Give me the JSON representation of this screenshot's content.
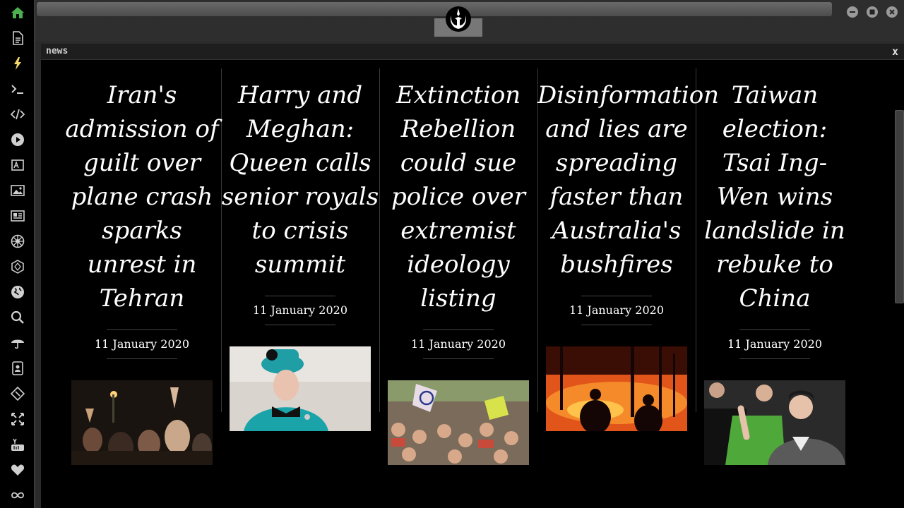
{
  "sidebar": {
    "icons": [
      {
        "name": "home-icon",
        "color": "#4caf50"
      },
      {
        "name": "document-icon",
        "color": "#cfcfcf"
      },
      {
        "name": "lightning-icon",
        "color": "#f5d76e"
      },
      {
        "name": "terminal-icon",
        "color": "#cfcfcf"
      },
      {
        "name": "code-icon",
        "color": "#cfcfcf"
      },
      {
        "name": "play-icon",
        "color": "#cfcfcf"
      },
      {
        "name": "translate-icon",
        "color": "#cfcfcf"
      },
      {
        "name": "image-icon",
        "color": "#cfcfcf"
      },
      {
        "name": "newspaper-icon",
        "color": "#cfcfcf"
      },
      {
        "name": "empire-icon",
        "color": "#cfcfcf"
      },
      {
        "name": "hexagon-icon",
        "color": "#cfcfcf"
      },
      {
        "name": "globe-icon",
        "color": "#cfcfcf"
      },
      {
        "name": "search-icon",
        "color": "#cfcfcf"
      },
      {
        "name": "umbrella-icon",
        "color": "#cfcfcf"
      },
      {
        "name": "contact-icon",
        "color": "#cfcfcf"
      },
      {
        "name": "git-icon",
        "color": "#cfcfcf"
      },
      {
        "name": "expand-icon",
        "color": "#cfcfcf"
      },
      {
        "name": "youtube-icon",
        "color": "#cfcfcf"
      },
      {
        "name": "heart-icon",
        "color": "#cfcfcf"
      },
      {
        "name": "infinity-icon",
        "color": "#cfcfcf"
      }
    ]
  },
  "panel": {
    "title": "news",
    "close_label": "x"
  },
  "articles": [
    {
      "headline_lines": [
        "Iran's",
        "admission of",
        "guilt over",
        "plane crash",
        "sparks",
        "unrest in",
        "Tehran"
      ],
      "date": "11 January 2020",
      "image": "protest-crowd-night"
    },
    {
      "headline_lines": [
        "Harry and",
        "Meghan:",
        "Queen calls",
        "senior royals",
        "to crisis",
        "summit"
      ],
      "date": "11 January 2020",
      "image": "queen-teal-hat"
    },
    {
      "headline_lines": [
        "Extinction",
        "Rebellion",
        "could sue",
        "police over",
        "extremist",
        "ideology",
        "listing"
      ],
      "date": "11 January 2020",
      "image": "extinction-rebellion-march"
    },
    {
      "headline_lines": [
        "Disinformation",
        "and lies are",
        "spreading",
        "faster than",
        "Australia's",
        "bushfires"
      ],
      "date": "11 January 2020",
      "image": "bushfire-firefighters"
    },
    {
      "headline_lines": [
        "Taiwan",
        "election:",
        "Tsai Ing-",
        "Wen wins",
        "landslide in",
        "rebuke to",
        "China"
      ],
      "date": "11 January 2020",
      "image": "tsai-ing-wen-waving"
    }
  ]
}
